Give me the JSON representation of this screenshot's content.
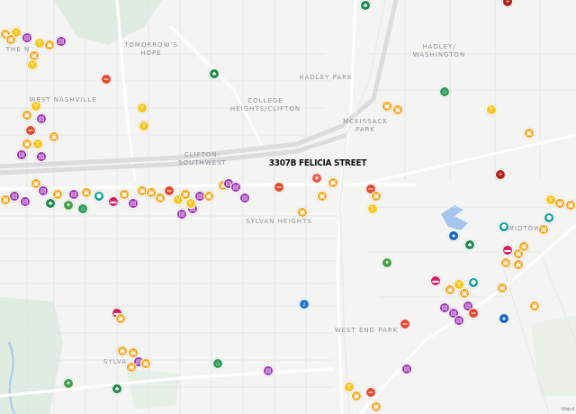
{
  "map": {
    "address_label": "3307B FELICIA STREET",
    "neighborhoods": [
      {
        "id": "tomorrows-hope",
        "lines": [
          "TOMORROW'S",
          "HOPE"
        ]
      },
      {
        "id": "hadley-park",
        "lines": [
          "HADLEY PARK"
        ]
      },
      {
        "id": "hadley-washington",
        "lines": [
          "HADLEY/",
          "WASHINGTON"
        ]
      },
      {
        "id": "west-nashville",
        "lines": [
          "WEST NASHVILLE"
        ]
      },
      {
        "id": "college-heights",
        "lines": [
          "COLLEGE",
          "HEIGHTS/CLIFTON"
        ]
      },
      {
        "id": "mckissack-park",
        "lines": [
          "MCKISSACK",
          "PARK"
        ]
      },
      {
        "id": "clifton-southwest",
        "lines": [
          "CLIFTON-",
          "SOUTHWEST"
        ]
      },
      {
        "id": "sylvan-heights",
        "lines": [
          "SYLVAN HEIGHTS"
        ]
      },
      {
        "id": "midtown",
        "lines": [
          "MIDTOW"
        ]
      },
      {
        "id": "west-end-park",
        "lines": [
          "WEST END PARK"
        ]
      },
      {
        "id": "sylvan-park",
        "lines": [
          "SYLVA"
        ]
      },
      {
        "id": "the-nations",
        "lines": [
          "THE N"
        ]
      }
    ],
    "attribution": "Map d",
    "colors": {
      "restaurant": "#f2a51a",
      "bar": "#f7c51b",
      "shopping": "#9b2fae",
      "gym": "#e2492f",
      "health": "#b0231c",
      "park": "#1f8a4c",
      "music": "#1e7ccf",
      "coffee": "#d81b60",
      "pet": "#43a047",
      "grocery": "#2e9e5a",
      "transit": "#0b9c9c",
      "sports": "#1565c0",
      "current": "#f25449"
    }
  }
}
